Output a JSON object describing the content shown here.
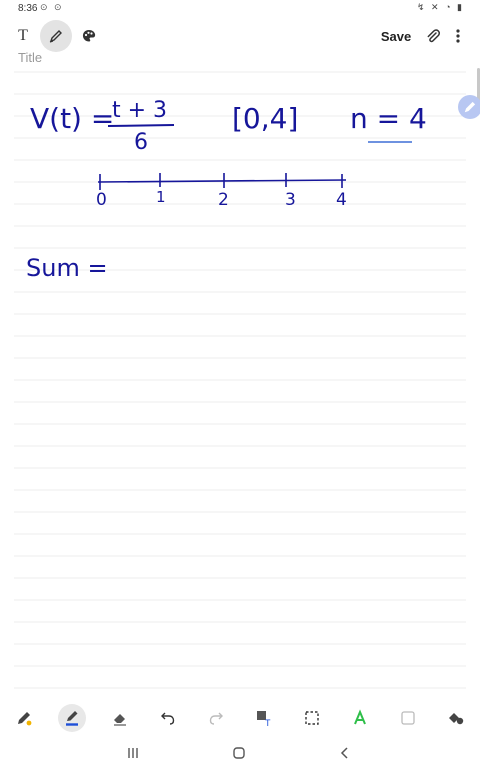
{
  "status": {
    "time": "8:36",
    "notif_icons": "⊙ ⊙",
    "right_icons": "↯ ✕ ◔ ▮"
  },
  "toolbar": {
    "text_tool_label": "T",
    "save_label": "Save"
  },
  "note": {
    "title_placeholder": "Title",
    "ink": {
      "v_lhs": "V(t) =",
      "numerator": "t + 3",
      "denominator": "6",
      "interval": "[0,4]",
      "n_eq": "n = 4",
      "ticks": [
        "0",
        "1",
        "2",
        "3",
        "4"
      ],
      "sum_label": "Sum ="
    }
  },
  "colors": {
    "ink": "#16169a",
    "underline": "#3f6fd6",
    "accent_green": "#2fbf4a"
  },
  "icons": {
    "toolbar": [
      "text-icon",
      "pen-icon",
      "palette-icon",
      "attach-icon",
      "more-icon"
    ],
    "bottom": [
      "pen-icon",
      "highlighter-icon",
      "eraser-icon",
      "undo-icon",
      "redo-icon",
      "text-box-icon",
      "selection-icon",
      "shape-icon",
      "square-icon",
      "fill-icon"
    ],
    "nav": [
      "recents-icon",
      "home-icon",
      "back-icon"
    ]
  }
}
